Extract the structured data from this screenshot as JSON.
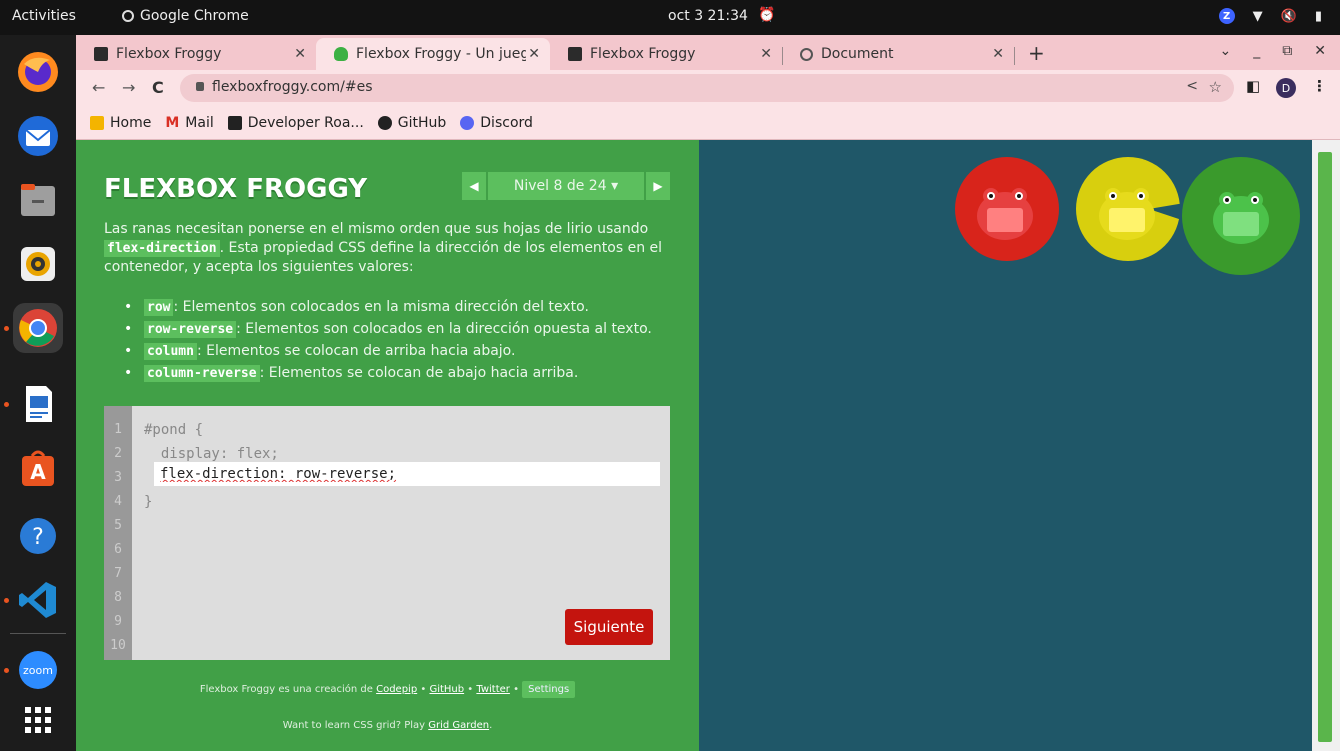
{
  "topbar": {
    "activities": "Activities",
    "app_name": "Google Chrome",
    "clock": "oct 3  21:34"
  },
  "dock": {
    "items": [
      "firefox",
      "thunderbird",
      "files",
      "rhythmbox",
      "chrome",
      "libreoffice-writer",
      "app-center",
      "help",
      "vscode",
      "zoom",
      "show-apps"
    ],
    "zoom_label": "zoom"
  },
  "tabs": [
    {
      "title": "Flexbox Froggy",
      "favicon": "ruler-icon"
    },
    {
      "title": "Flexbox Froggy - Un jueg",
      "favicon": "frog-icon",
      "active": true
    },
    {
      "title": "Flexbox Froggy",
      "favicon": "ruler-icon"
    },
    {
      "title": "Document",
      "favicon": "globe-icon"
    }
  ],
  "toolbar": {
    "url": "flexboxfroggy.com/#es",
    "profile_initial": "D"
  },
  "bookmarks": [
    {
      "label": "Home",
      "color": "#f4b400"
    },
    {
      "label": "Mail",
      "color": "#d93025"
    },
    {
      "label": "Developer Roa...",
      "color": "#222222"
    },
    {
      "label": "GitHub",
      "color": "#222222"
    },
    {
      "label": "Discord",
      "color": "#5865f2"
    }
  ],
  "game": {
    "logo": "FLEXBOX FROGGY",
    "level": "Nivel 8 de 24 ▾",
    "intro_before": "Las ranas necesitan ponerse en el mismo orden que sus hojas de lirio usando ",
    "intro_keyword": "flex-direction",
    "intro_after": ". Esta propiedad CSS define la dirección de los elementos en el contenedor, y acepta los siguientes valores:",
    "values": [
      {
        "keyword": "row",
        "text": ": Elementos son colocados en la misma dirección del texto."
      },
      {
        "keyword": "row-reverse",
        "text": ": Elementos son colocados en la dirección opuesta al texto."
      },
      {
        "keyword": "column",
        "text": ": Elementos se colocan de arriba hacia abajo."
      },
      {
        "keyword": "column-reverse",
        "text": ": Elementos se colocan de abajo hacia arriba."
      }
    ],
    "line_numbers": [
      "1",
      "2",
      "3",
      "4",
      "5",
      "6",
      "7",
      "8",
      "9",
      "10"
    ],
    "code_line1": "#pond {",
    "code_line2": "  display: flex;",
    "code_input": "flex-direction: row-reverse;",
    "code_line4": "}",
    "next_button": "Siguiente",
    "credits_prefix": "Flexbox Froggy es una creación de ",
    "credits_codepip": "Codepip",
    "credits_sep": " • ",
    "credits_github": "GitHub",
    "credits_twitter": "Twitter",
    "settings": "Settings",
    "promo_prefix": "Want to learn CSS grid? Play ",
    "promo_link": "Grid Garden",
    "promo_suffix": "."
  },
  "pond": {
    "frogs": [
      {
        "color": "red",
        "lily": "#d8241b",
        "body": "#ff6b6b"
      },
      {
        "color": "yellow",
        "lily": "#d8cf0e",
        "body": "#fff16b"
      },
      {
        "color": "green",
        "lily": "#3a9a2c",
        "body": "#72e074"
      }
    ],
    "water": "#1f5768"
  }
}
